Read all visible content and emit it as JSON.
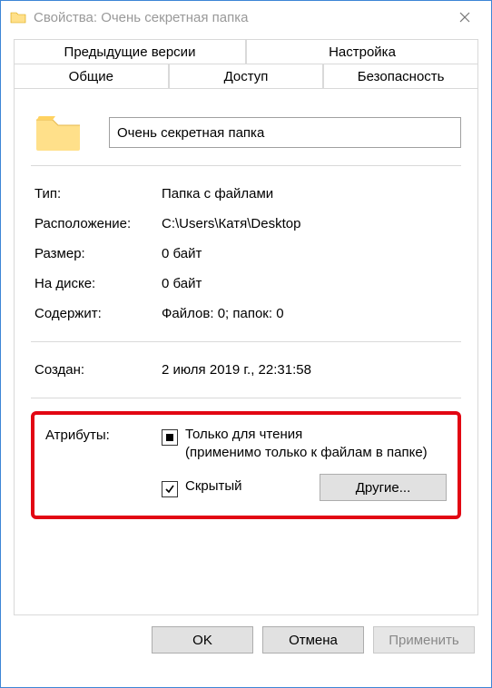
{
  "window": {
    "title": "Свойства: Очень секретная папка"
  },
  "tabs": {
    "upper": [
      "Предыдущие версии",
      "Настройка"
    ],
    "lower": [
      "Общие",
      "Доступ",
      "Безопасность"
    ],
    "active": "Общие"
  },
  "folder_name": "Очень секретная папка",
  "props": {
    "type_label": "Тип:",
    "type_value": "Папка с файлами",
    "location_label": "Расположение:",
    "location_value": "C:\\Users\\Катя\\Desktop",
    "size_label": "Размер:",
    "size_value": "0 байт",
    "ondisk_label": "На диске:",
    "ondisk_value": "0 байт",
    "contains_label": "Содержит:",
    "contains_value": "Файлов: 0; папок: 0",
    "created_label": "Создан:",
    "created_value": "2 июля 2019 г., 22:31:58"
  },
  "attributes": {
    "section_label": "Атрибуты:",
    "readonly_label": "Только для чтения",
    "readonly_note": "(применимо только к файлам в папке)",
    "readonly_state": "indeterminate",
    "hidden_label": "Скрытый",
    "hidden_state": "checked",
    "other_button": "Другие..."
  },
  "footer": {
    "ok": "OK",
    "cancel": "Отмена",
    "apply": "Применить"
  },
  "icons": {
    "folder": "folder-icon",
    "close": "close-icon"
  }
}
